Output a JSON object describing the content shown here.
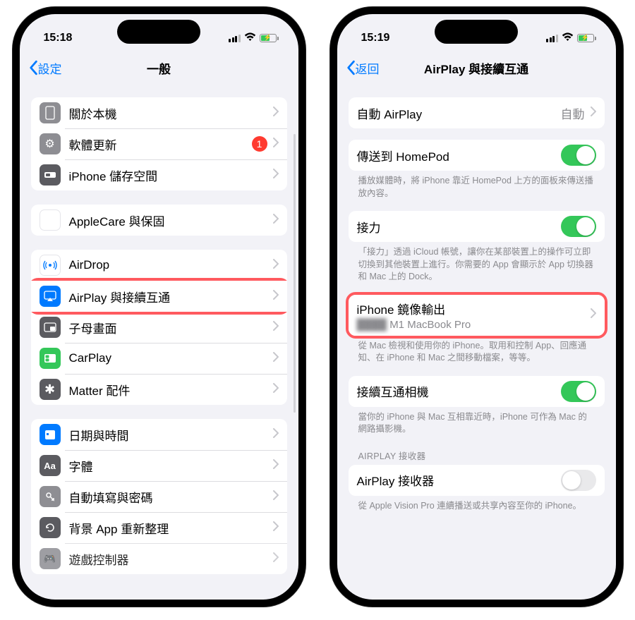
{
  "left": {
    "time": "15:18",
    "back": "設定",
    "title": "一般",
    "group1": [
      {
        "icon": "device-icon",
        "bg": "ic-gray",
        "glyph": "▢",
        "label": "關於本機"
      },
      {
        "icon": "gear-icon",
        "bg": "ic-gray",
        "glyph": "⚙",
        "label": "軟體更新",
        "badge": "1"
      },
      {
        "icon": "storage-icon",
        "bg": "ic-dgray",
        "glyph": "▬",
        "label": "iPhone 儲存空間"
      }
    ],
    "group2": [
      {
        "icon": "applecare-icon",
        "bg": "ic-white",
        "glyph": "",
        "label": "AppleCare 與保固"
      }
    ],
    "group3": [
      {
        "icon": "airdrop-icon",
        "bg": "ic-white",
        "glyph": "◎",
        "label": "AirDrop",
        "color": "#007aff"
      },
      {
        "icon": "airplay-icon",
        "bg": "ic-blue",
        "glyph": "▣",
        "label": "AirPlay 與接續互通",
        "hl": true
      },
      {
        "icon": "pip-icon",
        "bg": "ic-dgray",
        "glyph": "⧉",
        "label": "子母畫面"
      },
      {
        "icon": "carplay-icon",
        "bg": "ic-green",
        "glyph": "C",
        "label": "CarPlay"
      },
      {
        "icon": "matter-icon",
        "bg": "ic-dgray",
        "glyph": "✱",
        "label": "Matter 配件"
      }
    ],
    "group4": [
      {
        "icon": "datetime-icon",
        "bg": "ic-blue",
        "glyph": "⊞",
        "label": "日期與時間"
      },
      {
        "icon": "fonts-icon",
        "bg": "ic-dgray",
        "glyph": "Aa",
        "label": "字體"
      },
      {
        "icon": "autofill-icon",
        "bg": "ic-gray",
        "glyph": "🗝",
        "label": "自動填寫與密碼"
      },
      {
        "icon": "bgapp-icon",
        "bg": "ic-dgray",
        "glyph": "↻",
        "label": "背景 App 重新整理"
      },
      {
        "icon": "gamectrl-icon",
        "bg": "ic-gray",
        "glyph": "🎮",
        "label": "遊戲控制器"
      }
    ]
  },
  "right": {
    "time": "15:19",
    "back": "返回",
    "title": "AirPlay 與接續互通",
    "autoairplay_label": "自動 AirPlay",
    "autoairplay_value": "自動",
    "homepod_label": "傳送到 HomePod",
    "homepod_footer": "播放媒體時，將 iPhone 靠近 HomePod 上方的面板來傳送播放內容。",
    "handoff_label": "接力",
    "handoff_footer": "「接力」透過 iCloud 帳號，讓你在某部裝置上的操作可立即切換到其他裝置上進行。你需要的 App 會顯示於 App 切換器和 Mac 上的 Dock。",
    "mirror_label": "iPhone 鏡像輸出",
    "mirror_sub_prefix": "",
    "mirror_sub": "M1 MacBook Pro",
    "mirror_footer": "從 Mac 檢視和使用你的 iPhone。取用和控制 App、回應通知、在 iPhone 和 Mac 之間移動檔案，等等。",
    "camera_label": "接續互通相機",
    "camera_footer": "當你的 iPhone 與 Mac 互相靠近時，iPhone 可作為 Mac 的網路攝影機。",
    "receiver_header": "AIRPLAY 接收器",
    "receiver_label": "AirPlay 接收器",
    "receiver_footer": "從 Apple Vision Pro 連續播送或共享內容至你的 iPhone。"
  }
}
